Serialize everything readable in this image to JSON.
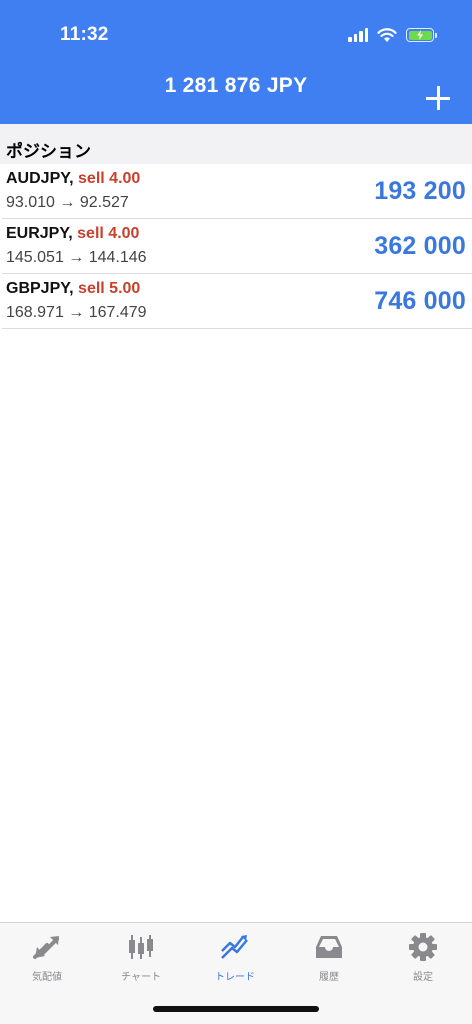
{
  "status_bar": {
    "time": "11:32"
  },
  "header": {
    "balance": "1 281 876 JPY",
    "add_icon": "plus-icon"
  },
  "section": {
    "title": "ポジション"
  },
  "positions": [
    {
      "symbol": "AUDJPY,",
      "side": "sell 4.00",
      "prices": "93.010 → 92.527",
      "profit": "193 200"
    },
    {
      "symbol": "EURJPY,",
      "side": "sell 4.00",
      "prices": "145.051 → 144.146",
      "profit": "362 000"
    },
    {
      "symbol": "GBPJPY,",
      "side": "sell 5.00",
      "prices": "168.971 → 167.479",
      "profit": "746 000"
    }
  ],
  "tabs": [
    {
      "label": "気配値",
      "icon": "quotes-arrows-icon"
    },
    {
      "label": "チャート",
      "icon": "candlestick-icon"
    },
    {
      "label": "トレード",
      "icon": "trade-trend-icon",
      "active": true
    },
    {
      "label": "履歴",
      "icon": "history-tray-icon"
    },
    {
      "label": "設定",
      "icon": "gear-icon"
    }
  ],
  "colors": {
    "accent": "#3f7ff1",
    "profit": "#3a78de",
    "sell": "#c8412c",
    "tab_inactive": "#8a8a8e"
  }
}
